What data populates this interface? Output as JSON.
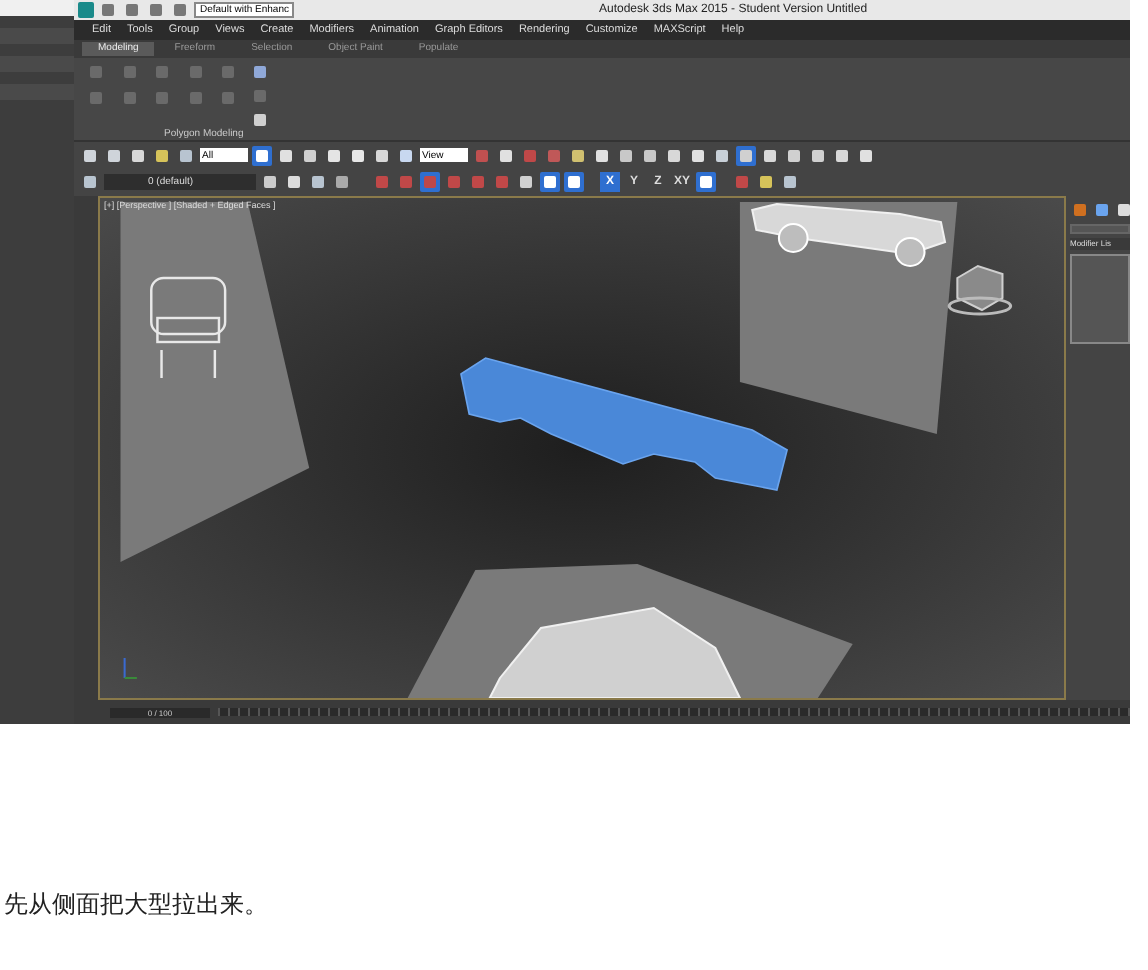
{
  "window": {
    "workspace_dropdown": "Default with Enhanc",
    "title": "Autodesk 3ds Max 2015 - Student Version Untitled"
  },
  "menu": [
    "Edit",
    "Tools",
    "Group",
    "Views",
    "Create",
    "Modifiers",
    "Animation",
    "Graph Editors",
    "Rendering",
    "Customize",
    "MAXScript",
    "Help"
  ],
  "ribbon": {
    "tabs": [
      {
        "label": "Modeling",
        "selected": true
      },
      {
        "label": "Freeform",
        "selected": false
      },
      {
        "label": "Selection",
        "selected": false
      },
      {
        "label": "Object Paint",
        "selected": false
      },
      {
        "label": "Populate",
        "selected": false
      }
    ],
    "panel_label": "Polygon Modeling"
  },
  "main_toolbar": {
    "selection_filter": "All",
    "reference_coordinate": "View"
  },
  "layer_toolbar": {
    "layer": "0 (default)",
    "axis_buttons": [
      {
        "label": "X",
        "selected": true
      },
      {
        "label": "Y",
        "selected": false
      },
      {
        "label": "Z",
        "selected": false
      },
      {
        "label": "XY",
        "selected": false
      }
    ]
  },
  "viewport": {
    "label": "[+] [Perspective ] [Shaded + Edged Faces ]"
  },
  "command_panel": {
    "modifier_list": "Modifier Lis"
  },
  "timeline": {
    "frame_counter": "0 / 100"
  },
  "caption": "先从侧面把大型拉出来。"
}
